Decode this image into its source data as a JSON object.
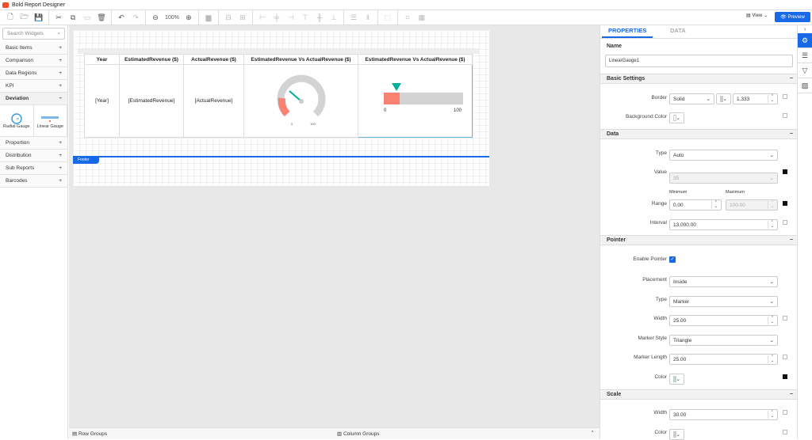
{
  "app": {
    "title": "Bold Report Designer",
    "zoom": "100%",
    "view_label": "View",
    "preview_label": "Preview",
    "accent": "#1769e8"
  },
  "left": {
    "search_placeholder": "Search Widgets",
    "categories_top": [
      "Basic Items",
      "Comparison",
      "Data Regions",
      "KPI"
    ],
    "open_category": "Deviation",
    "widgets": [
      "Radial Gauge",
      "Linear Gauge"
    ],
    "categories_bottom": [
      "Proportion",
      "Distribution",
      "Sub Reports",
      "Barcodes"
    ]
  },
  "report": {
    "headers": [
      "Year",
      "EstimatedRevenue ($)",
      "ActualRevenue ($)",
      "EstimatedRevenue Vs ActualRevenue ($)",
      "EstimatedRevenue Vs ActualRevenue ($)"
    ],
    "cells": [
      "[Year]",
      "[EstimatedRevenue]",
      "[ActualRevenue]"
    ],
    "radial": {
      "min": "0",
      "max": "100"
    },
    "linear": {
      "min": "0",
      "max": "100",
      "range_color": "#f98272",
      "pointer_color": "#00b09b"
    },
    "footer_label": "Footer"
  },
  "bottom": {
    "row_groups": "Row Groups",
    "column_groups": "Column Groups"
  },
  "props": {
    "tabs": [
      "PROPERTIES",
      "DATA"
    ],
    "name_label": "Name",
    "name_value": "LinearGauge1",
    "sections": {
      "basic": "Basic Settings",
      "data": "Data",
      "pointer": "Pointer",
      "scale": "Scale"
    },
    "basic": {
      "border_label": "Border",
      "border_style": "Solid",
      "border_width": "1.333",
      "bg_label": "Background Color"
    },
    "data": {
      "type_label": "Type",
      "type_value": "Auto",
      "value_label": "Value",
      "value_value": "35",
      "range_label": "Range",
      "min_label": "Minimum",
      "max_label": "Maximum",
      "min_value": "0.00",
      "max_value": "100.00",
      "interval_label": "Interval",
      "interval_value": "13,000.00"
    },
    "pointer": {
      "enable_label": "Enable Pointer",
      "enabled": true,
      "placement_label": "Placement",
      "placement_value": "Inside",
      "type_label": "Type",
      "type_value": "Marker",
      "width_label": "Width",
      "width_value": "25.00",
      "marker_style_label": "Marker Style",
      "marker_style_value": "Triangle",
      "marker_length_label": "Marker Length",
      "marker_length_value": "25.00",
      "color_label": "Color",
      "color_value": "#9fe0d3"
    },
    "scale": {
      "width_label": "Width",
      "width_value": "30.00",
      "color_label": "Color"
    }
  }
}
